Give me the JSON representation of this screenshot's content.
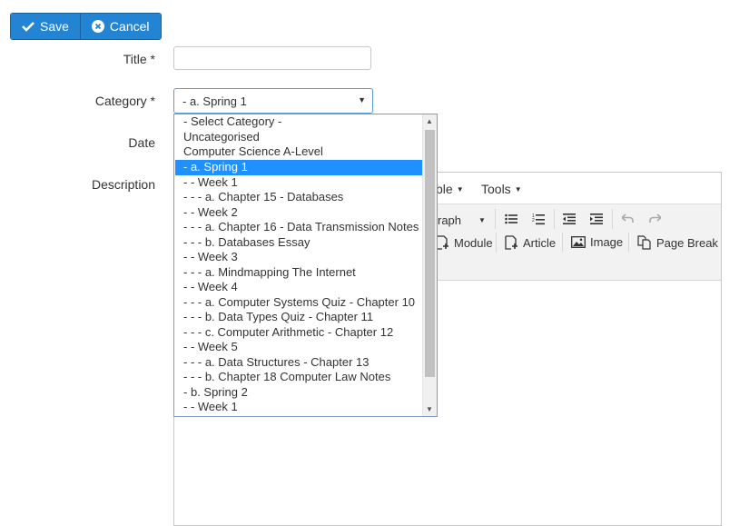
{
  "toolbar": {
    "save_label": "Save",
    "cancel_label": "Cancel"
  },
  "form": {
    "title_label": "Title *",
    "title_value": "",
    "category_label": "Category *",
    "category_value": "- a. Spring 1",
    "date_label": "Date",
    "description_label": "Description"
  },
  "category_options": [
    "- Select Category -",
    "Uncategorised",
    "Computer Science A-Level",
    "- a. Spring 1",
    "- - Week 1",
    "- - - a. Chapter 15 - Databases",
    "- - Week 2",
    "- - - a. Chapter 16 - Data Transmission Notes",
    "- - - b. Databases Essay",
    "- - Week 3",
    "- - - a. Mindmapping The Internet",
    "- - Week 4",
    "- - - a. Computer Systems Quiz - Chapter 10",
    "- - - b. Data Types Quiz - Chapter 11",
    "- - - c. Computer Arithmetic - Chapter 12",
    "- - Week 5",
    "- - - a. Data Structures - Chapter 13",
    "- - - b. Chapter 18 Computer Law Notes",
    "- b. Spring 2",
    "- - Week 1"
  ],
  "selected_option_index": 3,
  "editor": {
    "menu_table_partial": "ble",
    "menu_tools": "Tools",
    "format_partial": "raph",
    "module_label": "Module",
    "article_label": "Article",
    "image_label": "Image",
    "page_break_label": "Page Break"
  },
  "colors": {
    "primary": "#2384d3",
    "selected_option": "#1e90ff"
  }
}
